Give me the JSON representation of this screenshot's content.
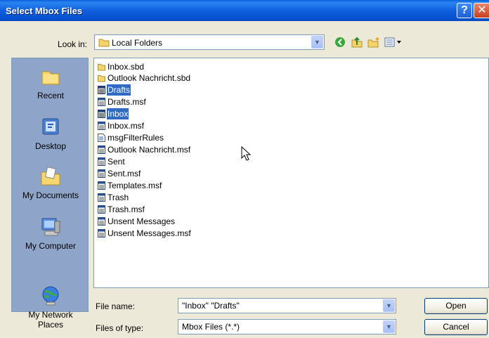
{
  "window": {
    "title": "Select Mbox Files",
    "help_label": "?",
    "close_label": "✕"
  },
  "lookin": {
    "label": "Look in:",
    "value": "Local Folders",
    "toolbar_icons": [
      "back-icon",
      "up-folder-icon",
      "new-folder-icon",
      "view-menu-icon"
    ]
  },
  "places": [
    {
      "label": "Recent",
      "icon": "recent-icon"
    },
    {
      "label": "Desktop",
      "icon": "desktop-icon"
    },
    {
      "label": "My Documents",
      "icon": "my-documents-icon"
    },
    {
      "label": "My Computer",
      "icon": "my-computer-icon"
    },
    {
      "label": "My Network\nPlaces",
      "icon": "network-places-icon"
    }
  ],
  "files": [
    {
      "name": "Inbox.sbd",
      "type": "folder",
      "selected": false
    },
    {
      "name": "Outlook Nachricht.sbd",
      "type": "folder",
      "selected": false
    },
    {
      "name": "Drafts",
      "type": "file",
      "selected": true
    },
    {
      "name": "Drafts.msf",
      "type": "file",
      "selected": false
    },
    {
      "name": "Inbox",
      "type": "file",
      "selected": true
    },
    {
      "name": "Inbox.msf",
      "type": "file",
      "selected": false
    },
    {
      "name": "msgFilterRules",
      "type": "doc",
      "selected": false
    },
    {
      "name": "Outlook Nachricht.msf",
      "type": "file",
      "selected": false
    },
    {
      "name": "Sent",
      "type": "file",
      "selected": false
    },
    {
      "name": "Sent.msf",
      "type": "file",
      "selected": false
    },
    {
      "name": "Templates.msf",
      "type": "file",
      "selected": false
    },
    {
      "name": "Trash",
      "type": "file",
      "selected": false
    },
    {
      "name": "Trash.msf",
      "type": "file",
      "selected": false
    },
    {
      "name": "Unsent Messages",
      "type": "file",
      "selected": false
    },
    {
      "name": "Unsent Messages.msf",
      "type": "file",
      "selected": false
    }
  ],
  "filename": {
    "label": "File name:",
    "value": "\"Inbox\" \"Drafts\""
  },
  "filetype": {
    "label": "Files of type:",
    "value": "Mbox Files (*.*)"
  },
  "buttons": {
    "open": "Open",
    "cancel": "Cancel"
  },
  "colors": {
    "title_bar": "#0a5fd8",
    "selection": "#316ac5",
    "dialog_bg": "#ece9d8",
    "places_bg": "#8ea4c8"
  }
}
